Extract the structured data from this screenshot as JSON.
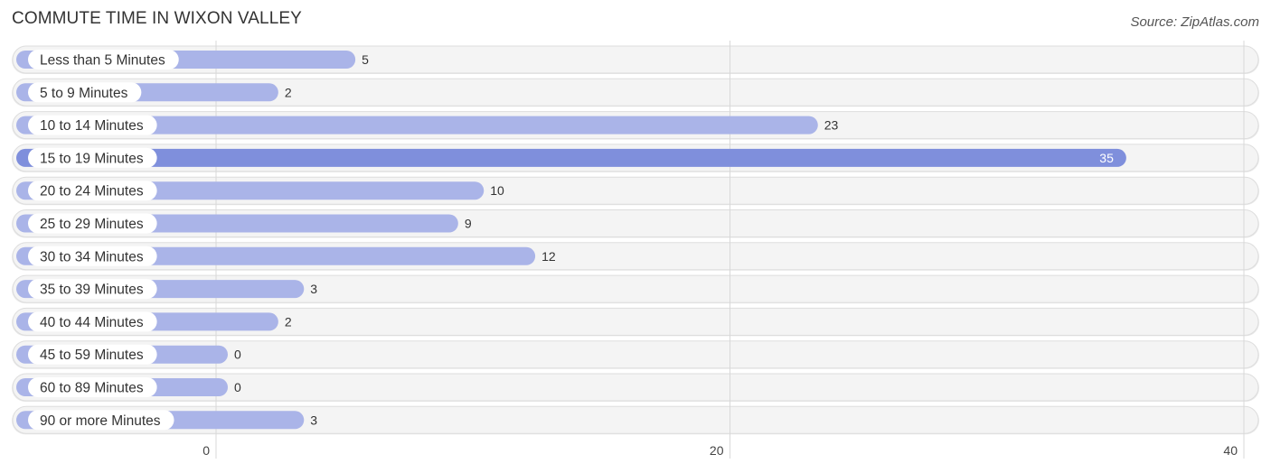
{
  "header": {
    "title": "COMMUTE TIME IN WIXON VALLEY",
    "source": "Source: ZipAtlas.com"
  },
  "colors": {
    "bar": "#aab4e8",
    "bar_highlight": "#7f8fdc",
    "row_background": "#f4f4f4"
  },
  "chart_data": {
    "type": "bar",
    "orientation": "horizontal",
    "title": "COMMUTE TIME IN WIXON VALLEY",
    "xlabel": "",
    "ylabel": "",
    "categories": [
      "Less than 5 Minutes",
      "5 to 9 Minutes",
      "10 to 14 Minutes",
      "15 to 19 Minutes",
      "20 to 24 Minutes",
      "25 to 29 Minutes",
      "30 to 34 Minutes",
      "35 to 39 Minutes",
      "40 to 44 Minutes",
      "45 to 59 Minutes",
      "60 to 89 Minutes",
      "90 or more Minutes"
    ],
    "values": [
      5,
      2,
      23,
      35,
      10,
      9,
      12,
      3,
      2,
      0,
      0,
      3
    ],
    "highlight_index": 3,
    "xlim": [
      0,
      40
    ],
    "xticks": [
      0,
      20,
      40
    ],
    "xtick_labels": [
      "0",
      "20",
      "40"
    ],
    "grid": true,
    "legend": "none"
  }
}
